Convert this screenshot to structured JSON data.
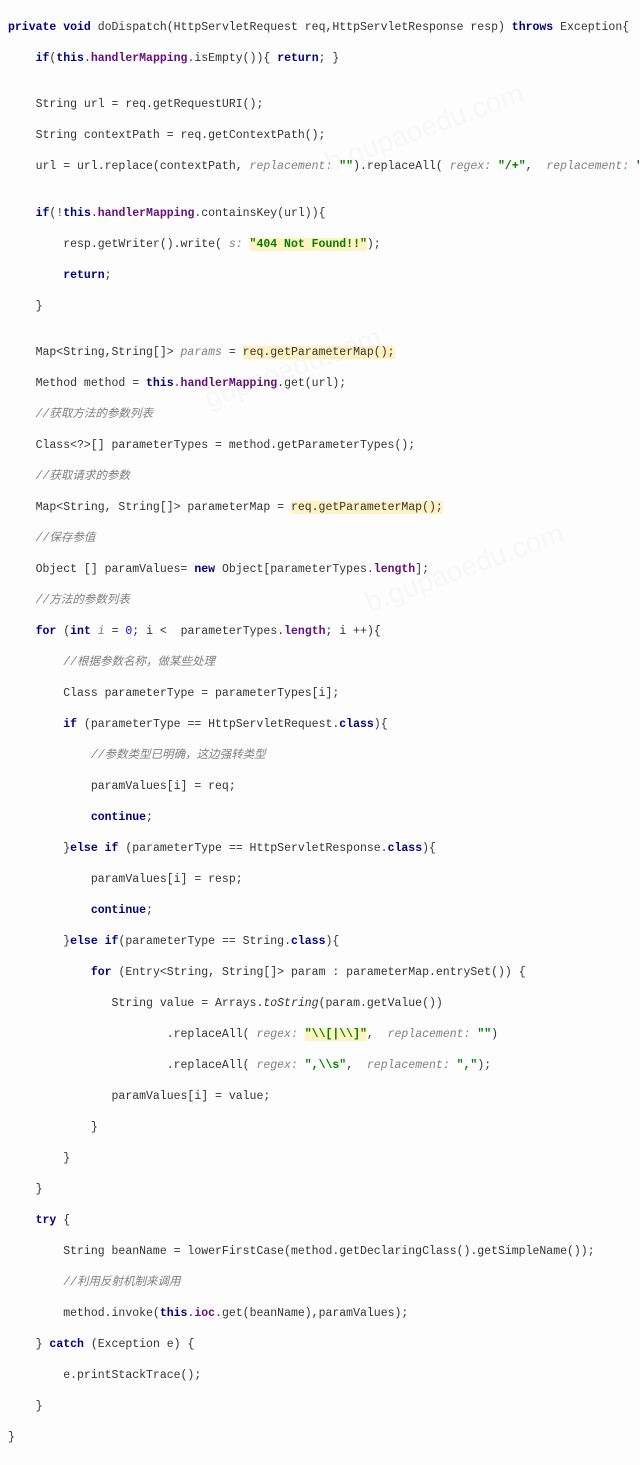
{
  "watermarks": [
    "b.gupaoedu.com",
    "gupaoedu.com"
  ],
  "code": {
    "l1": "private void doDispatch(HttpServletRequest req,HttpServletResponse resp) throws Exception{",
    "l2a": "    if(this.",
    "l2b": "handlerMapping",
    "l2c": ".isEmpty()){ return; }",
    "l3": "",
    "l4": "    String url = req.getRequestURI();",
    "l5": "    String contextPath = req.getContextPath();",
    "l6a": "    url = url.replace(contextPath, ",
    "l6h1": "replacement: ",
    "l6s1": "\"\"",
    "l6b": ").replaceAll(",
    "l6h2": " regex: ",
    "l6s2": "\"/+\"",
    "l6c": ",  ",
    "l6h3": "replacement: ",
    "l6s3": "\"/\"",
    "l6d": ");",
    "l7": "",
    "l8a": "    if(!this.",
    "l8b": "handlerMapping",
    "l8c": ".containsKey(url)){",
    "l9a": "        resp.getWriter().write(",
    "l9h": " s: ",
    "l9s": "\"404 Not Found!!\"",
    "l9b": ");",
    "l10": "        return;",
    "l11": "    }",
    "l12": "",
    "l13a": "    Map<String,String[]> ",
    "l13b": "params",
    "l13c": " = ",
    "l13hl": "req.getParameterMap();",
    "l14a": "    Method method = this.",
    "l14b": "handlerMapping",
    "l14c": ".get(url);",
    "l15": "    //获取方法的参数列表",
    "l16": "    Class<?>[] parameterTypes = method.getParameterTypes();",
    "l17": "    //获取请求的参数",
    "l18a": "    Map<String, String[]> parameterMap = ",
    "l18hl": "req.getParameterMap();",
    "l19": "    //保存参值",
    "l20a": "    Object [] paramValues= new Object[parameterTypes.",
    "l20b": "length",
    "l20c": "];",
    "l21": "    //方法的参数列表",
    "l22a": "    for (int ",
    "l22b": "i",
    "l22c": " = ",
    "l22n": "0",
    "l22d": "; i <  parameterTypes.",
    "l22e": "length",
    "l22f": "; i ++){",
    "l23": "        //根据参数名称，做某些处理",
    "l24": "        Class parameterType = parameterTypes[i];",
    "l25a": "        if (parameterType == HttpServletRequest.class){",
    "l26": "            //参数类型已明确，这边强转类型",
    "l27": "            paramValues[i] = req;",
    "l28": "            continue;",
    "l29a": "        }else if (parameterType == HttpServletResponse.class){",
    "l30": "            paramValues[i] = resp;",
    "l31": "            continue;",
    "l32a": "        }else if(parameterType == String.class){",
    "l33a": "            for (Entry<String, String[]> param : parameterMap.entrySet()) {",
    "l34a": "               String value = Arrays.toString(param.getValue())",
    "l35a": "                       .replaceAll(",
    "l35h1": " regex: ",
    "l35s1": "\"\\\\[|\\\\]\"",
    "l35b": ",  ",
    "l35h2": "replacement: ",
    "l35s2": "\"\"",
    "l35c": ")",
    "l36a": "                       .replaceAll(",
    "l36h1": " regex: ",
    "l36s1": "\",\\\\s\"",
    "l36b": ",  ",
    "l36h2": "replacement: ",
    "l36s2": "\",\"",
    "l36c": ");",
    "l37": "               paramValues[i] = value;",
    "l38": "            }",
    "l39": "        }",
    "l40": "    }",
    "l41a": "    try {",
    "l42": "        String beanName = lowerFirstCase(method.getDeclaringClass().getSimpleName());",
    "l43": "        //利用反射机制来调用",
    "l44a": "        method.invoke(this.",
    "l44b": "ioc",
    "l44c": ".get(beanName),paramValues);",
    "l45a": "    } catch (Exception e) {",
    "l46": "        e.printStackTrace();",
    "l47": "    }",
    "l48": "}"
  }
}
